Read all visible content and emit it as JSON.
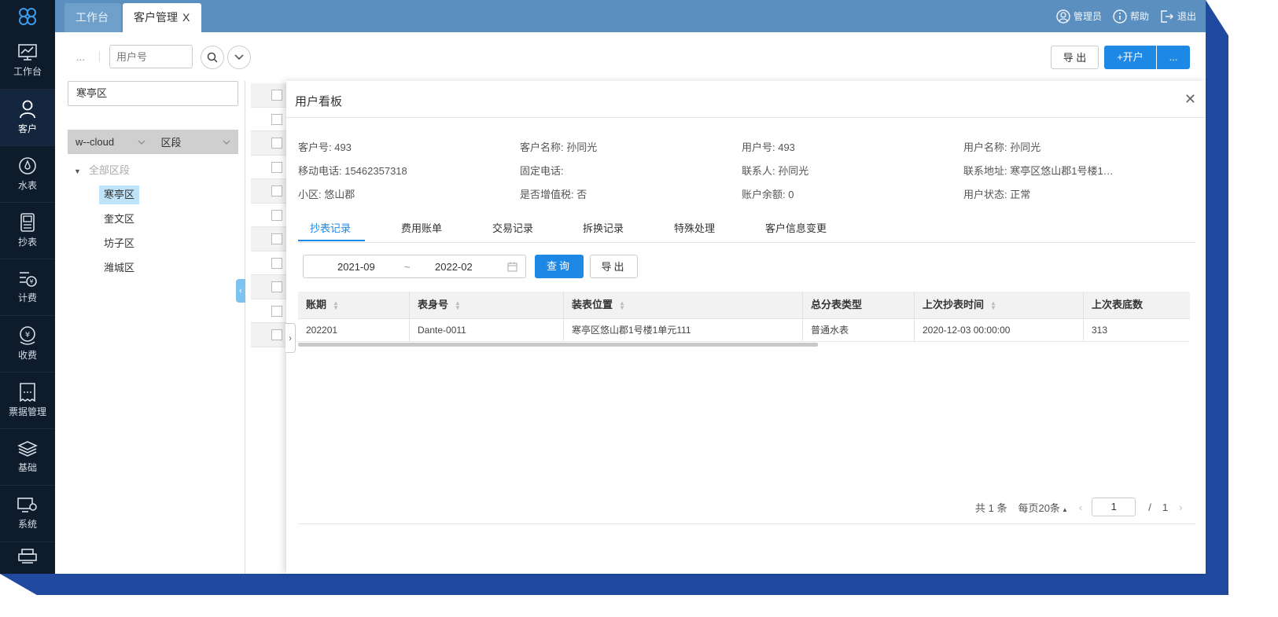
{
  "sidebar": {
    "items": [
      {
        "label": "工作台",
        "icon": "monitor-chart-icon"
      },
      {
        "label": "客户",
        "icon": "user-icon"
      },
      {
        "label": "水表",
        "icon": "meter-icon"
      },
      {
        "label": "抄表",
        "icon": "device-icon"
      },
      {
        "label": "计费",
        "icon": "billing-icon"
      },
      {
        "label": "收费",
        "icon": "payment-icon"
      },
      {
        "label": "票据管理",
        "icon": "ticket-icon"
      },
      {
        "label": "基础",
        "icon": "layers-icon"
      },
      {
        "label": "系统",
        "icon": "system-settings-icon"
      }
    ]
  },
  "topbar": {
    "tabs": [
      {
        "label": "工作台"
      },
      {
        "label": "客户管理",
        "close": "X"
      }
    ],
    "admin": "管理员",
    "help": "帮助",
    "logout": "退出"
  },
  "toolbar": {
    "dots": "...",
    "user_placeholder": "用户号",
    "export_label": "导 出",
    "open_account_label": "+开户",
    "more_label": "..."
  },
  "left": {
    "district_value": "寒亭区",
    "filter_cloud": "w--cloud",
    "filter_segment": "区段",
    "tree_root": "全部区段",
    "tree_nodes": [
      "寒亭区",
      "奎文区",
      "坊子区",
      "潍城区"
    ]
  },
  "drawer": {
    "title": "用户看板",
    "info": [
      "客户号: 493",
      "客户名称: 孙同光",
      "用户号: 493",
      "用户名称: 孙同光",
      "移动电话: 15462357318",
      "固定电话:",
      "联系人: 孙同光",
      "联系地址: 寒亭区悠山郡1号楼1…",
      "小区: 悠山郡",
      "是否增值税: 否",
      "账户余额: 0",
      "用户状态: 正常"
    ],
    "tabs": [
      "抄表记录",
      "费用账单",
      "交易记录",
      "拆换记录",
      "特殊处理",
      "客户信息变更"
    ],
    "date_from": "2021-09",
    "date_tilde": "~",
    "date_to": "2022-02",
    "query_label": "查询",
    "export_label": "导出",
    "table": {
      "headers": [
        "账期",
        "表身号",
        "装表位置",
        "总分表类型",
        "上次抄表时间",
        "上次表底数"
      ],
      "rows": [
        [
          "202201",
          "Dante-0011",
          "寒亭区悠山郡1号楼1单元111",
          "普通水表",
          "2020-12-03 00:00:00",
          "313"
        ]
      ]
    },
    "pager": {
      "total": "共 1 条",
      "per_page": "每页20条",
      "page": "1",
      "slash": "/",
      "pages": "1"
    }
  }
}
